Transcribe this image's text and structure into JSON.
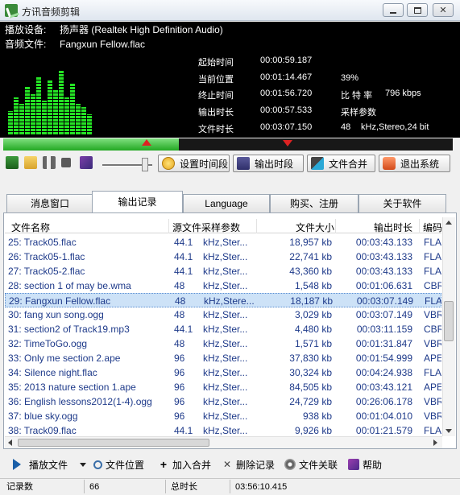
{
  "window": {
    "title": "方讯音频剪辑",
    "minimize": "▭",
    "maximize": "▢",
    "close": "✕"
  },
  "info": {
    "device_label": "播放设备:",
    "device_value": "扬声器 (Realtek High Definition Audio)",
    "file_label": "音频文件:",
    "file_value": "Fangxun Fellow.flac"
  },
  "stats": {
    "start_label": "起始时间",
    "start_value": "00:00:59.187",
    "current_label": "当前位置",
    "current_value": "00:01:14.467",
    "current_pct": "39%",
    "end_label": "终止时间",
    "end_value": "00:01:56.720",
    "bitrate_label": "比 特 率",
    "bitrate_value": "796 kbps",
    "outlen_label": "输出时长",
    "outlen_value": "00:00:57.533",
    "params_label": "采样参数",
    "filelen_label": "文件时长",
    "filelen_value": "00:03:07.150",
    "params_rate": "48",
    "params_value": "kHz,Stereo,24 bit"
  },
  "equalizer_levels": [
    0.35,
    0.55,
    0.45,
    0.7,
    0.6,
    0.85,
    0.5,
    0.8,
    0.65,
    0.95,
    0.55,
    0.75,
    0.45,
    0.4,
    0.3
  ],
  "playback_progress": 0.39,
  "volume_level": 0.85,
  "toolbar": {
    "set_time_label": "设置时间段",
    "export_label": "输出时段",
    "merge_label": "文件合并",
    "exit_label": "退出系统"
  },
  "tabs": [
    {
      "label": "消息窗口",
      "active": false
    },
    {
      "label": "输出记录",
      "active": true
    },
    {
      "label": "Language",
      "active": false
    },
    {
      "label": "购买、注册",
      "active": false
    },
    {
      "label": "关于软件",
      "active": false
    }
  ],
  "table": {
    "headers": [
      "文件名称",
      "源文件采样参数",
      "文件大小",
      "输出时长",
      "编码"
    ],
    "rows": [
      {
        "name": "25: Track05.flac",
        "rate": "44.1",
        "params": "kHz,Ster...",
        "size": "18,957 kb",
        "duration": "00:03:43.133",
        "enc": "FLAC"
      },
      {
        "name": "26: Track05-1.flac",
        "rate": "44.1",
        "params": "kHz,Ster...",
        "size": "22,741 kb",
        "duration": "00:03:43.133",
        "enc": "FLAC"
      },
      {
        "name": "27: Track05-2.flac",
        "rate": "44.1",
        "params": "kHz,Ster...",
        "size": "43,360 kb",
        "duration": "00:03:43.133",
        "enc": "FLAC"
      },
      {
        "name": "28: section 1 of may be.wma",
        "rate": "48",
        "params": "kHz,Ster...",
        "size": "1,548 kb",
        "duration": "00:01:06.631",
        "enc": "CBR,"
      },
      {
        "name": "29: Fangxun Fellow.flac",
        "rate": "48",
        "params": "kHz,Stere...",
        "size": "18,187 kb",
        "duration": "00:03:07.149",
        "enc": "FLAC",
        "selected": true
      },
      {
        "name": "30: fang xun song.ogg",
        "rate": "48",
        "params": "kHz,Ster...",
        "size": "3,029 kb",
        "duration": "00:03:07.149",
        "enc": "VBR"
      },
      {
        "name": "31: section2 of  Track19.mp3",
        "rate": "44.1",
        "params": "kHz,Ster...",
        "size": "4,480 kb",
        "duration": "00:03:11.159",
        "enc": "CBR,"
      },
      {
        "name": "32: TimeToGo.ogg",
        "rate": "48",
        "params": "kHz,Ster...",
        "size": "1,571 kb",
        "duration": "00:01:31.847",
        "enc": "VBR"
      },
      {
        "name": "33: Only me section 2.ape",
        "rate": "96",
        "params": "kHz,Ster...",
        "size": "37,830 kb",
        "duration": "00:01:54.999",
        "enc": "APE"
      },
      {
        "name": "34: Silence night.flac",
        "rate": "96",
        "params": "kHz,Ster...",
        "size": "30,324 kb",
        "duration": "00:04:24.938",
        "enc": "FLAC"
      },
      {
        "name": "35: 2013 nature section 1.ape",
        "rate": "96",
        "params": "kHz,Ster...",
        "size": "84,505 kb",
        "duration": "00:03:43.121",
        "enc": "APE"
      },
      {
        "name": "36: English lessons2012(1-4).ogg",
        "rate": "96",
        "params": "kHz,Ster...",
        "size": "24,729 kb",
        "duration": "00:26:06.178",
        "enc": "VBR"
      },
      {
        "name": "37: blue sky.ogg",
        "rate": "96",
        "params": "kHz,Ster...",
        "size": "938 kb",
        "duration": "00:01:04.010",
        "enc": "VBR"
      },
      {
        "name": "38: Track09.flac",
        "rate": "44.1",
        "params": "kHz,Ster...",
        "size": "9,926 kb",
        "duration": "00:01:21.579",
        "enc": "FLAC"
      }
    ]
  },
  "actions": {
    "play": "播放文件",
    "locate": "文件位置",
    "join": "加入合并",
    "delete": "删除记录",
    "assoc": "文件关联",
    "help": "帮助"
  },
  "status": {
    "count_label": "记录数",
    "count_value": "66",
    "total_label": "总时长",
    "total_value": "03:56:10.415"
  },
  "colors": {
    "accent_green": "#23a823",
    "row_text": "#1e3a8a",
    "marker_red": "#d22222",
    "selected_row": "#cde2f7"
  }
}
